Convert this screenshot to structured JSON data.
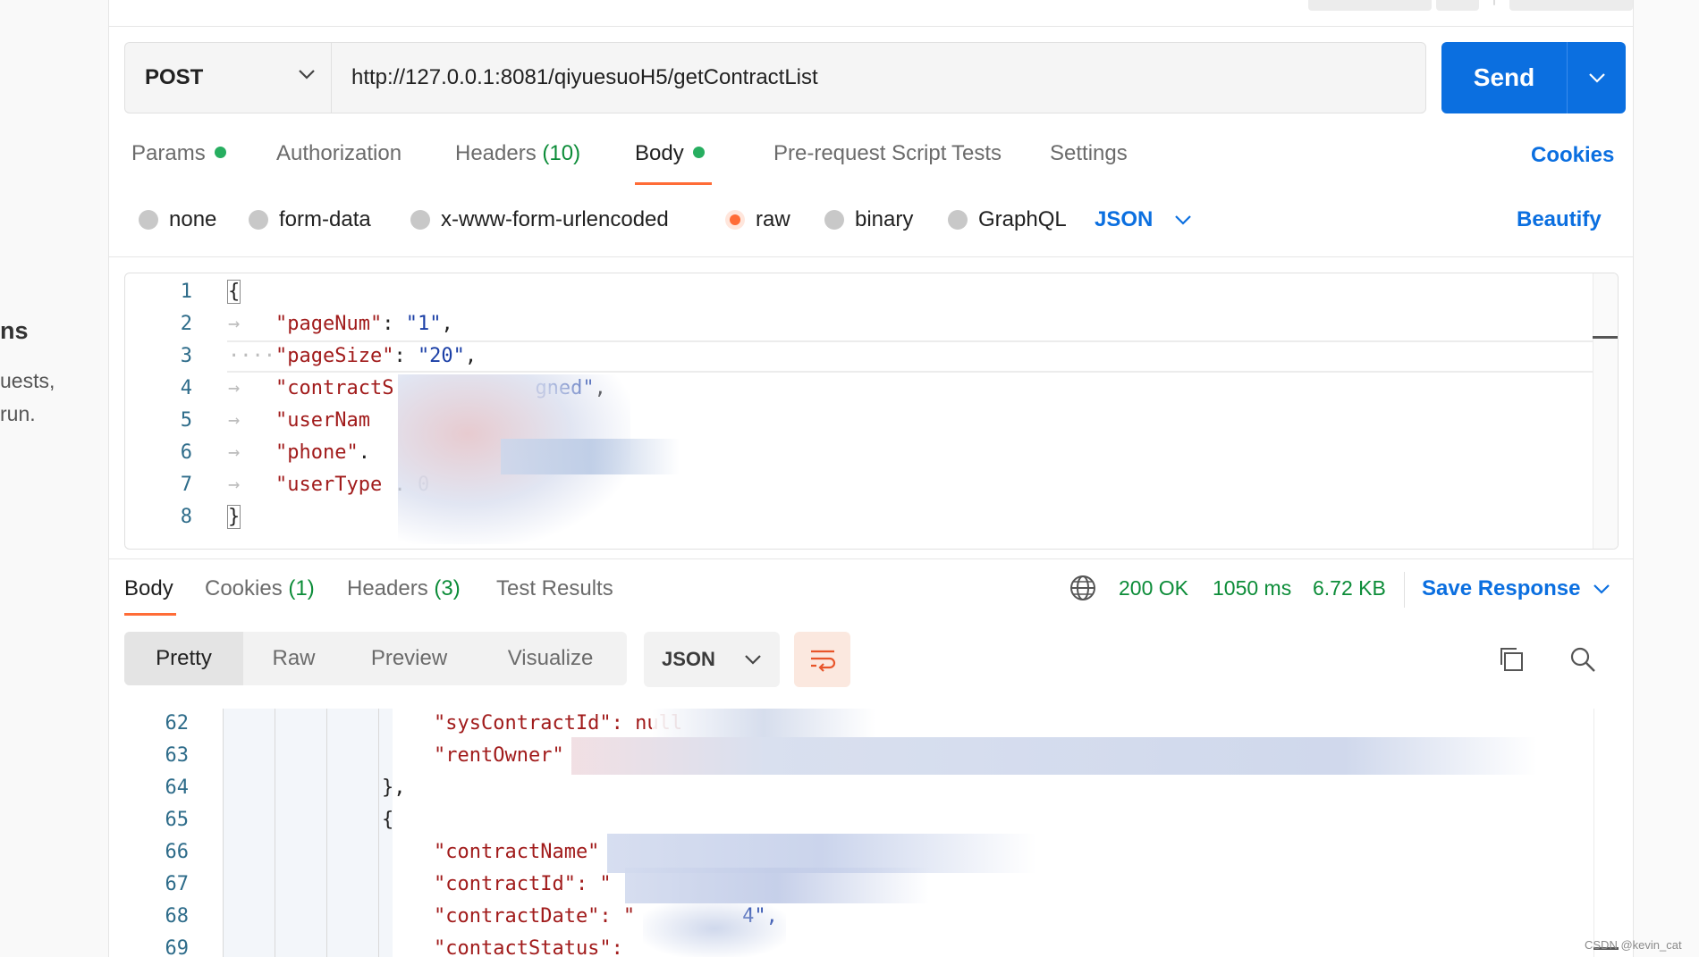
{
  "sidebar_fragment": {
    "title": "ns",
    "lines": [
      "uests,",
      "run."
    ]
  },
  "request": {
    "method": "POST",
    "url": "http://127.0.0.1:8081/qiyuesuoH5/getContractList",
    "send_label": "Send"
  },
  "request_tabs": {
    "params": "Params",
    "authorization": "Authorization",
    "headers": "Headers",
    "headers_count": "(10)",
    "body": "Body",
    "pre_request": "Pre-request Script",
    "tests": "Tests",
    "settings": "Settings",
    "cookies": "Cookies"
  },
  "body_types": {
    "options": [
      "none",
      "form-data",
      "x-www-form-urlencoded",
      "raw",
      "binary",
      "GraphQL"
    ],
    "selected": "raw",
    "language": "JSON",
    "beautify": "Beautify"
  },
  "request_body": {
    "line_numbers": [
      "1",
      "2",
      "3",
      "4",
      "5",
      "6",
      "7",
      "8"
    ],
    "lines": [
      {
        "open": "{"
      },
      {
        "key": "\"pageNum\"",
        "sep": ": ",
        "value": "\"1\"",
        "end": ","
      },
      {
        "key": "\"pageSize\"",
        "sep": ": ",
        "value": "\"20\"",
        "end": ","
      },
      {
        "key": "\"contractS",
        "sep": "",
        "value": "gned\"",
        "end": ","
      },
      {
        "key": "\"userNam",
        "sep": "",
        "value": "",
        "end": ""
      },
      {
        "key": "\"phone\"",
        "sep": ".",
        "value": "",
        "end": ""
      },
      {
        "key": "\"userType",
        "sep": " . ",
        "value": "0",
        "end": ""
      },
      {
        "close": "}"
      }
    ]
  },
  "response_tabs": {
    "body": "Body",
    "cookies": "Cookies",
    "cookies_count": "(1)",
    "headers": "Headers",
    "headers_count": "(3)",
    "test_results": "Test Results"
  },
  "response_status": {
    "status": "200 OK",
    "time": "1050 ms",
    "size": "6.72 KB",
    "save_response": "Save Response"
  },
  "response_view": {
    "modes": [
      "Pretty",
      "Raw",
      "Preview",
      "Visualize"
    ],
    "active_mode": "Pretty",
    "format": "JSON"
  },
  "response_body": {
    "line_numbers": [
      "62",
      "63",
      "64",
      "65",
      "66",
      "67",
      "68",
      "69"
    ],
    "lines": [
      {
        "text": "\"sysContractId\": null"
      },
      {
        "text": "\"rentOwner\""
      },
      {
        "text": "},"
      },
      {
        "text": "{"
      },
      {
        "text": "\"contractName\""
      },
      {
        "text": "\"contractId\": \""
      },
      {
        "text": "\"contractDate\": \"",
        "tail": "4\","
      },
      {
        "text": "\"contactStatus\":"
      }
    ]
  },
  "watermark": "CSDN @kevin_cat",
  "colors": {
    "accent_blue": "#0b6fe0",
    "tab_underline": "#ff6c37",
    "status_green": "#0c8c38",
    "json_key": "#a11b1b",
    "json_string": "#1b3fa6"
  }
}
